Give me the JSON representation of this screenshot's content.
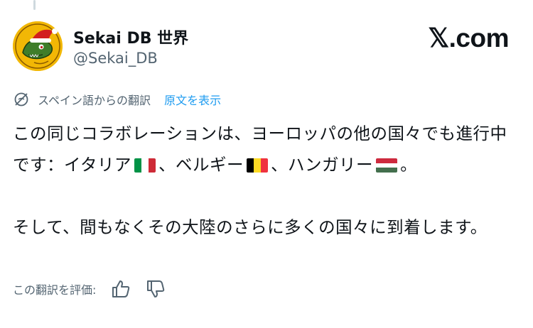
{
  "author": {
    "display_name": "Sekai DB 世界",
    "handle": "@Sekai_DB"
  },
  "brand": {
    "site": "𝕏.com"
  },
  "translation": {
    "label": "スペイン語からの翻訳",
    "show_original": "原文を表示"
  },
  "tweet": {
    "line1_prefix": "この同じコラボレーションは、ヨーロッパの他の国々でも進行中です：イタリア",
    "sep1": "、ベルギー",
    "sep2": "、ハンガリー",
    "end": "。",
    "paragraph2": "そして、間もなくその大陸のさらに多くの国々に到着します。",
    "flags": [
      {
        "country": "Italy",
        "colors": [
          "#009246",
          "#ffffff",
          "#ce2b37"
        ]
      },
      {
        "country": "Belgium",
        "colors": [
          "#000000",
          "#fdda24",
          "#ef3340"
        ]
      },
      {
        "country": "Hungary",
        "colors": [
          "#cd2a3e",
          "#ffffff",
          "#436f4d"
        ]
      }
    ]
  },
  "rating": {
    "label": "この翻訳を評価:",
    "thumbs_up_icon": "thumbs-up-icon",
    "thumbs_down_icon": "thumbs-down-icon"
  },
  "colors": {
    "text_primary": "#0f1419",
    "text_secondary": "#536471",
    "link": "#1d9bf0"
  }
}
